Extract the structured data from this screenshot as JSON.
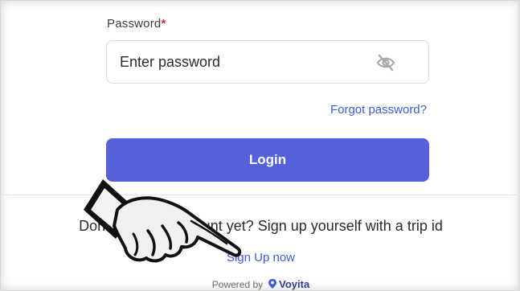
{
  "password": {
    "label": "Password",
    "required_mark": "*",
    "placeholder": "Enter password",
    "visibility_icon": "eye-off-icon"
  },
  "forgot_password": "Forgot password?",
  "login_button": "Login",
  "no_account_text": "Don't have an account yet? Sign up yourself with a trip id",
  "signup_link": "Sign Up now",
  "footer": {
    "powered_by": "Powered by",
    "brand": "Voyita",
    "brand_icon": "location-pin-icon"
  },
  "overlay": {
    "icon": "pointing-hand-icon"
  },
  "colors": {
    "accent": "#5660d9",
    "link": "#3f5bd6",
    "required": "#d32f2f",
    "brand": "#2e3d8f"
  }
}
